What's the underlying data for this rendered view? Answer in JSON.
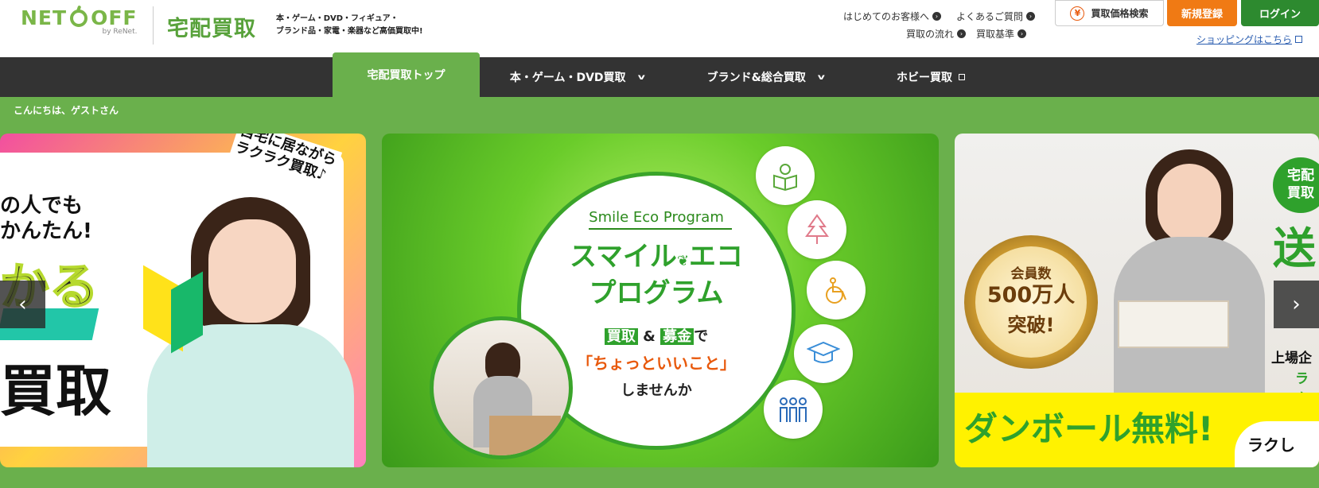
{
  "header": {
    "logo_text": "NET",
    "logo_text_2": "OFF",
    "logo_sub": "by ReNet.",
    "service_name": "宅配買取",
    "tagline_line1": "本・ゲーム・DVD・フィギュア・",
    "tagline_line2": "ブランド品・家電・楽器など高価買取中!",
    "links": {
      "first_time": "はじめてのお客様へ",
      "faq": "よくあるご質問",
      "flow": "買取の流れ",
      "criteria": "買取基準"
    },
    "price_search": "買取価格検索",
    "register": "新規登録",
    "login": "ログイン",
    "shopping": "ショッピングはこちら"
  },
  "nav": {
    "items": [
      {
        "label": "宅配買取トップ"
      },
      {
        "label": "本・ゲーム・DVD買取"
      },
      {
        "label": "ブランド&総合買取"
      },
      {
        "label": "ホビー買取"
      }
    ]
  },
  "greeting": "こんにちは、ゲストさん",
  "banners": {
    "left": {
      "corner": "自宅に居ながら",
      "corner2": "ラクラク買取♪",
      "line1": "の人でも",
      "line2": "かんたん!",
      "big": "かる",
      "big2": "買取"
    },
    "center": {
      "program_en": "Smile Eco Program",
      "title1": "スマイル",
      "title1b": "エコ",
      "title2": "プログラム",
      "chip1": "買取",
      "amp": "&",
      "chip2": "募金",
      "de": "で",
      "good_thing": "「ちょっといいこと」",
      "ending": "しませんか"
    },
    "right": {
      "badge_l1": "会員数",
      "badge_l2": "500万人",
      "badge_l3": "突破!",
      "corner_l1": "宅配",
      "corner_l2": "買取",
      "send": "送",
      "listed": "上場企",
      "raku": "ラク",
      "free_box": "ダンボール無料!",
      "easy": "ラクし"
    }
  },
  "colors": {
    "brand_green": "#6ab04c",
    "nav_dark": "#333333",
    "register_orange": "#f07a14",
    "login_green": "#2d8a2f"
  }
}
